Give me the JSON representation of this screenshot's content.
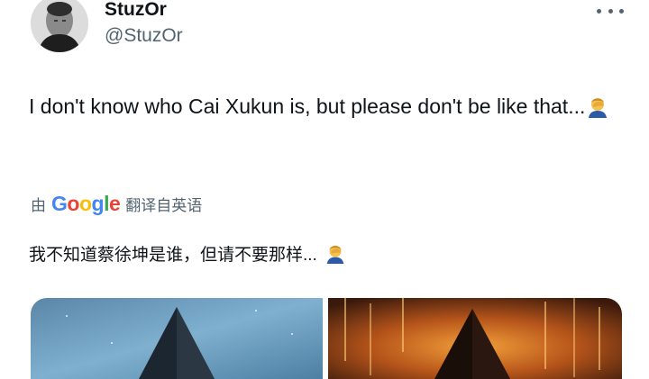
{
  "author": {
    "display_name": "StuzOr",
    "handle": "@StuzOr",
    "avatar_icon": "profile-photo"
  },
  "tweet": {
    "text_before_emoji": "I don't know who Cai Xukun is, but please don't be like that...",
    "emoji_icon": "person-facepalming-emoji"
  },
  "translation": {
    "prefix": "由",
    "provider": "Google",
    "suffix": "翻译自英语",
    "translated_text": "我不知道蔡徐坤是谁，但请不要那样..."
  },
  "colors": {
    "text_primary": "#0f1419",
    "text_secondary": "#536471",
    "google_blue": "#4285F4",
    "google_red": "#EA4335",
    "google_yellow": "#FBBC05",
    "google_green": "#34A853"
  },
  "media": [
    {
      "icon": "dark-pyramid-over-blue-sky-image"
    },
    {
      "icon": "dark-pyramid-over-orange-glyph-rain-image"
    }
  ]
}
